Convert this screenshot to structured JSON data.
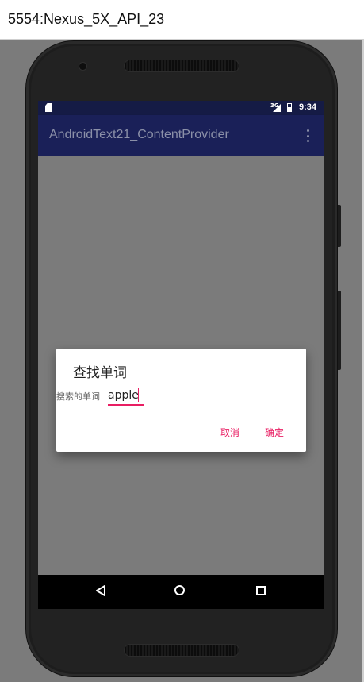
{
  "host": {
    "window_title": "5554:Nexus_5X_API_23"
  },
  "status_bar": {
    "network": "3G",
    "time": "9:34"
  },
  "app_bar": {
    "title": "AndroidText21_ContentProvider",
    "overflow_icon": "more-vert-icon"
  },
  "dialog": {
    "title": "查找单词",
    "field_label": "搜索的单词",
    "field_value": "apple",
    "cancel_label": "取消",
    "ok_label": "确定"
  },
  "nav_bar": {
    "back_icon": "back-icon",
    "home_icon": "home-icon",
    "recents_icon": "recents-icon"
  },
  "colors": {
    "accent": "#e91e63",
    "app_bar": "#1a2058",
    "status_bar": "#151b45"
  }
}
